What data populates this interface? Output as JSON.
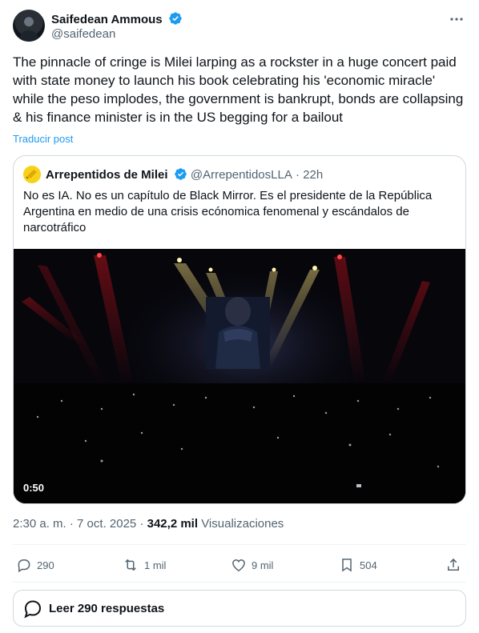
{
  "author": {
    "name": "Saifedean Ammous",
    "handle": "@saifedean"
  },
  "tweet": {
    "text": "The pinnacle of cringe is Milei larping as a rockster in a huge concert paid with state money to launch his book celebrating his 'economic miracle' while the peso implodes, the government is bankrupt, bonds are collapsing & his finance minister is in the US begging for a bailout",
    "translate_label": "Traducir post"
  },
  "quote": {
    "name": "Arrepentidos de Milei",
    "handle": "@ArrepentidosLLA",
    "separator": "·",
    "time": "22h",
    "text": "No es IA. No es un capítulo de Black Mirror. Es el presidente de la República Argentina en medio de una crisis ecónomica fenomenal y escándalos de narcotráfico",
    "video_duration": "0:50"
  },
  "meta": {
    "time": "2:30 a. m.",
    "date": "7 oct. 2025",
    "views_count": "342,2 mil",
    "views_label": "Visualizaciones"
  },
  "actions": {
    "replies": "290",
    "reposts": "1 mil",
    "likes": "9 mil",
    "bookmarks": "504"
  },
  "read_replies_label": "Leer 290 respuestas",
  "colors": {
    "accent": "#1d9bf0",
    "text": "#0f1419",
    "muted": "#536471",
    "border": "#cfd9de"
  },
  "icons": [
    "verified-badge-icon",
    "more-icon",
    "reply-icon",
    "repost-icon",
    "like-icon",
    "bookmark-icon",
    "share-icon",
    "replies-bubble-icon"
  ]
}
